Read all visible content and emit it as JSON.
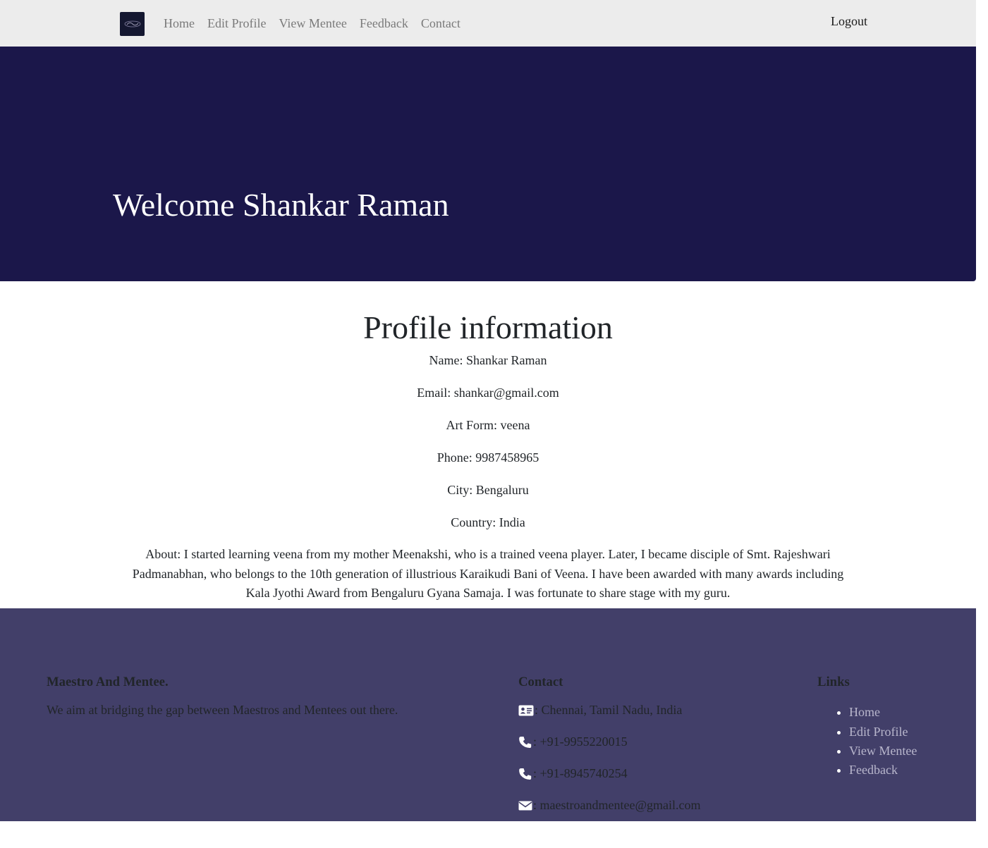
{
  "nav": {
    "links": [
      "Home",
      "Edit Profile",
      "View Mentee",
      "Feedback",
      "Contact"
    ],
    "logout": "Logout"
  },
  "hero": {
    "title": "Welcome Shankar Raman"
  },
  "profile": {
    "heading": "Profile information",
    "name": "Name: Shankar Raman",
    "email": "Email: shankar@gmail.com",
    "art_form": "Art Form: veena",
    "phone": "Phone: 9987458965",
    "city": "City: Bengaluru",
    "country": "Country: India",
    "about": "About: I started learning veena from my mother Meenakshi, who is a trained veena player. Later, I became disciple of Smt. Rajeshwari Padmanabhan, who belongs to the 10th generation of illustrious Karaikudi Bani of Veena. I have been awarded with many awards including Kala Jyothi Award from Bengaluru Gyana Samaja. I was fortunate to share stage with my guru."
  },
  "footer": {
    "brand_title": "Maestro And Mentee.",
    "brand_text": "We aim at bridging the gap between Maestros and Mentees out there.",
    "contact_title": "Contact",
    "address": ": Chennai, Tamil Nadu, India",
    "phone1": ": +91-9955220015",
    "phone2": ": +91-8945740254",
    "email": ": maestroandmentee@gmail.com",
    "links_title": "Links",
    "links": [
      "Home",
      "Edit Profile",
      "View Mentee",
      "Feedback"
    ]
  },
  "colors": {
    "navbar_bg": "#ececec",
    "hero_bg": "#1b174a",
    "footer_bg": "#423f69",
    "footer_link": "#b8b6cc"
  }
}
